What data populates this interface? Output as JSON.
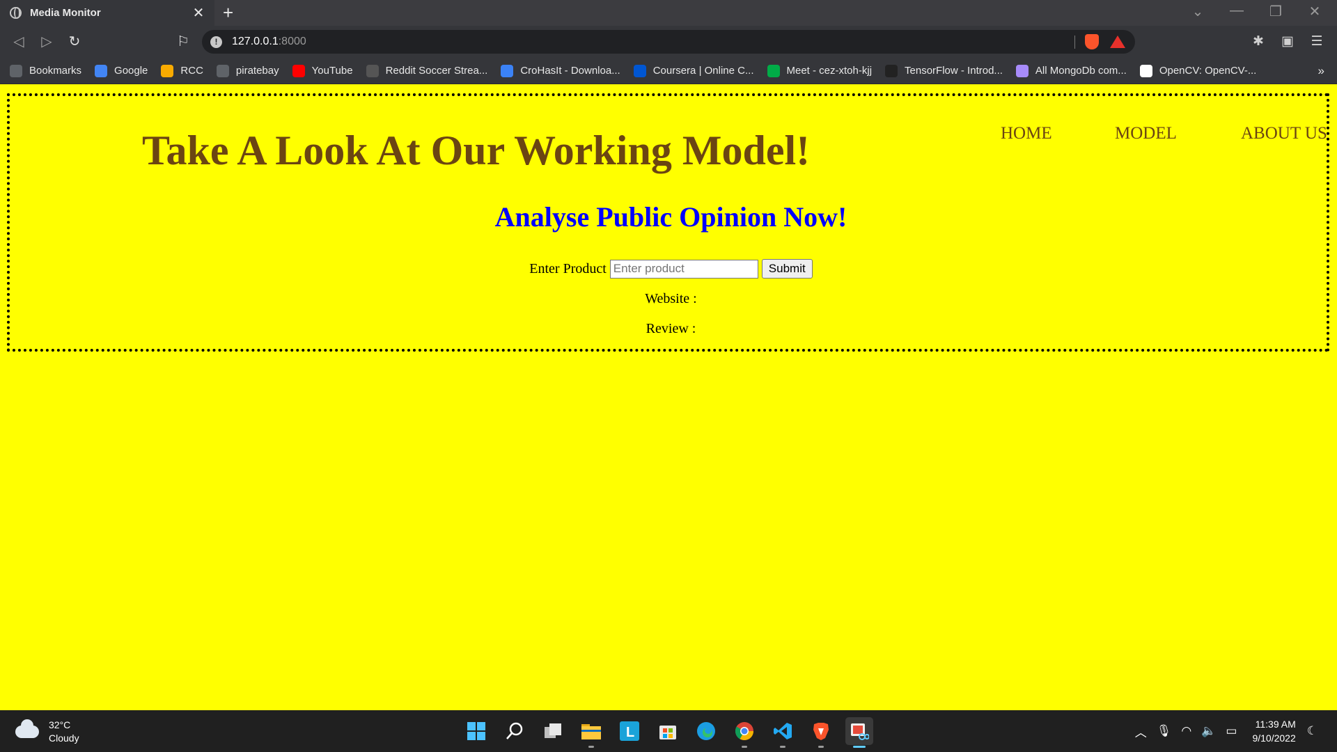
{
  "browser": {
    "tab_title": "Media Monitor",
    "tab_close": "✕",
    "new_tab": "+",
    "url_host": "127.0.0.1",
    "url_port": ":8000",
    "bookmarks": [
      {
        "label": "Bookmarks",
        "icon": "folder-icon",
        "color": "#5f6368"
      },
      {
        "label": "Google",
        "icon": "google-icon",
        "color": "#4285f4"
      },
      {
        "label": "RCC",
        "icon": "classroom-icon",
        "color": "#f9ab00"
      },
      {
        "label": "piratebay",
        "icon": "monitor-icon",
        "color": "#5f6368"
      },
      {
        "label": "YouTube",
        "icon": "youtube-icon",
        "color": "#ff0000"
      },
      {
        "label": "Reddit Soccer Strea...",
        "icon": "soccer-icon",
        "color": "#555555"
      },
      {
        "label": "CroHasIt - Downloa...",
        "icon": "gamepad-icon",
        "color": "#3b82f6"
      },
      {
        "label": "Coursera | Online C...",
        "icon": "coursera-icon",
        "color": "#0056d2"
      },
      {
        "label": "Meet - cez-xtoh-kjj",
        "icon": "meet-icon",
        "color": "#00ac47"
      },
      {
        "label": "TensorFlow - Introd...",
        "icon": "tensorflow-icon",
        "color": "#222222"
      },
      {
        "label": "All MongoDb com...",
        "icon": "avatar-icon",
        "color": "#a78bfa"
      },
      {
        "label": "OpenCV: OpenCV-...",
        "icon": "opencv-icon",
        "color": "#ffffff"
      }
    ],
    "bookmarks_more": "»"
  },
  "page": {
    "main_title": "Take A Look At Our Working Model!",
    "nav": [
      "HOME",
      "MODEL",
      "ABOUT US"
    ],
    "sub_title": "Analyse Public Opinion Now!",
    "form": {
      "label": "Enter Product",
      "placeholder": "Enter product",
      "value": "",
      "submit": "Submit"
    },
    "website_label": "Website :",
    "review_label": "Review :"
  },
  "taskbar": {
    "temperature": "32°C",
    "condition": "Cloudy",
    "time": "11:39 AM",
    "date": "9/10/2022"
  },
  "colors": {
    "page_bg": "#ffff00",
    "title": "#6b4512",
    "subtitle": "#0000ff"
  }
}
